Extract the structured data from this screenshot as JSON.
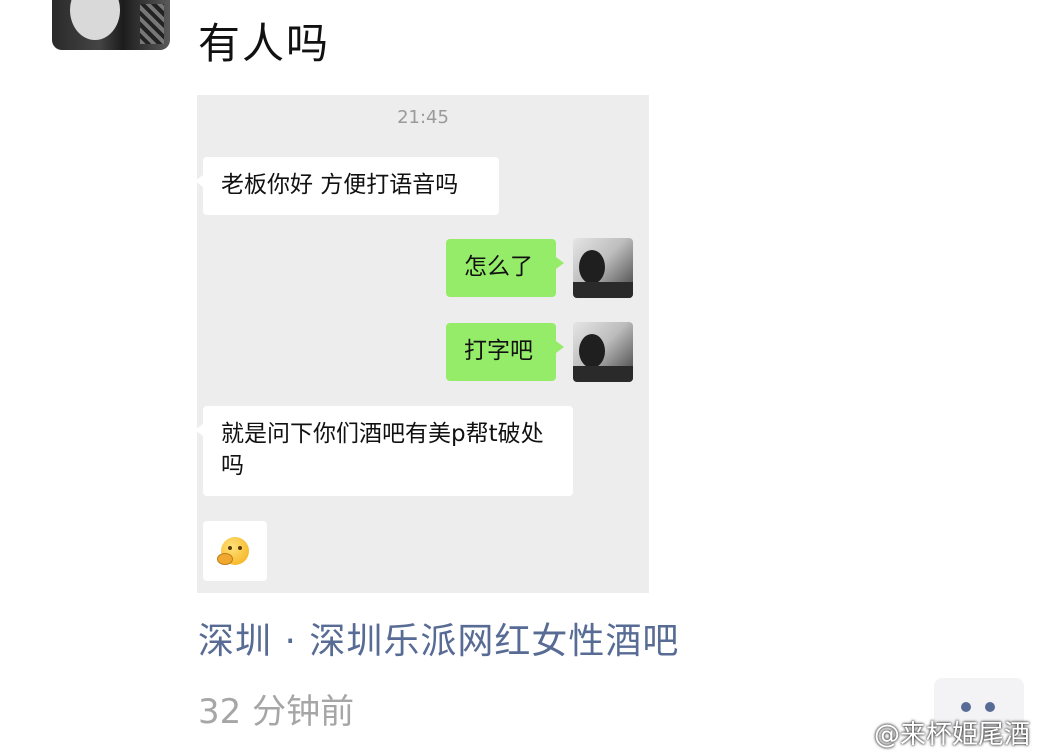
{
  "post": {
    "text": "有人吗",
    "location": "深圳 · 深圳乐派网红女性酒吧",
    "timestamp": "32 分钟前"
  },
  "chat": {
    "time": "21:45",
    "messages": [
      {
        "side": "left",
        "text": "老板你好  方便打语音吗"
      },
      {
        "side": "right",
        "text": "怎么了"
      },
      {
        "side": "right",
        "text": "打字吧"
      },
      {
        "side": "left",
        "text": "就是问下你们酒吧有美p帮t破处吗"
      },
      {
        "side": "left",
        "text": "",
        "emoji": "thinking-face-icon"
      }
    ]
  },
  "watermark": "@来杯姫尾酒",
  "colors": {
    "link": "#576b95",
    "bubble_right": "#95ec69",
    "chat_bg": "#ededed"
  }
}
